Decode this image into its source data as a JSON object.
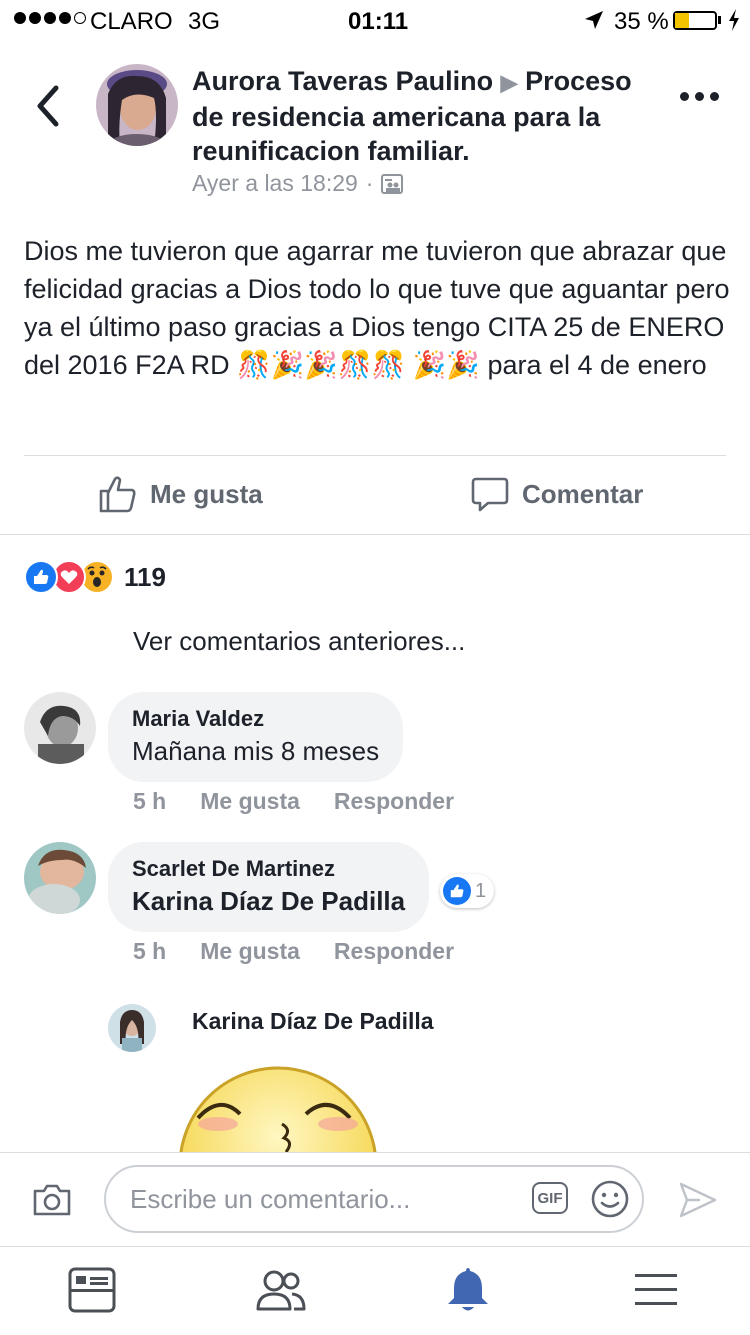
{
  "status_bar": {
    "carrier": "CLARO",
    "network": "3G",
    "time": "01:11",
    "battery": "35 %",
    "battery_level": 0.35
  },
  "post": {
    "author": "Aurora Taveras Paulino",
    "group": "Proceso de residencia americana para la reunificacion familiar.",
    "timestamp": "Ayer a las 18:29",
    "audience_icon": "group-icon",
    "text": "Dios me tuvieron que agarrar me tuvieron que abrazar que felicidad gracias a Dios todo lo que tuve que aguantar pero ya el último paso gracias a Dios tengo CITA 25 de ENERO del 2016 F2A RD 🎊🎉🎉🎊🎊 🎉🎉 para el 4 de enero",
    "like_label": "Me gusta",
    "comment_label": "Comentar"
  },
  "reactions": {
    "types": [
      "like",
      "love",
      "wow"
    ],
    "count": "119"
  },
  "comments": {
    "view_previous": "Ver comentarios anteriores...",
    "items": [
      {
        "name": "Maria Valdez",
        "text": "Mañana mis 8 meses",
        "time": "5 h",
        "like": "Me gusta",
        "reply": "Responder"
      },
      {
        "name": "Scarlet De Martinez",
        "text": "Karina Díaz De Padilla",
        "time": "5 h",
        "like": "Me gusta",
        "reply": "Responder",
        "like_count": "1"
      }
    ],
    "reply": {
      "name": "Karina Díaz De Padilla"
    }
  },
  "composer": {
    "placeholder": "Escribe un comentario...",
    "gif_label": "GIF"
  },
  "colors": {
    "accent": "#4267b2",
    "like_blue": "#1877f2",
    "love_red": "#f33e58",
    "wow_yellow": "#f7b125",
    "muted": "#90949c"
  }
}
